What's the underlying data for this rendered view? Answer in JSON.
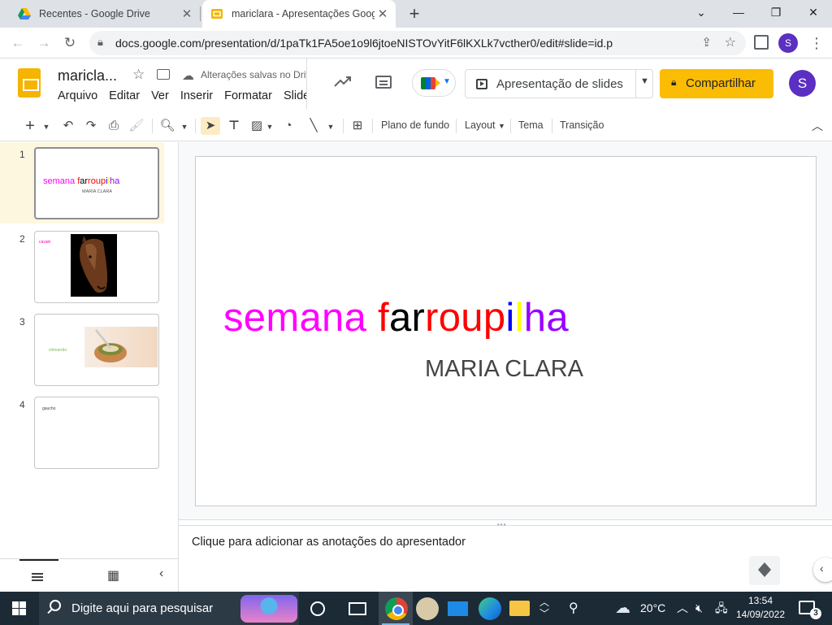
{
  "browser": {
    "tabs": [
      {
        "title": "Recentes - Google Drive",
        "icon": "google-drive-icon",
        "active": false
      },
      {
        "title": "mariclara - Apresentações Google",
        "icon": "google-slides-icon",
        "active": true
      }
    ],
    "url": "docs.google.com/presentation/d/1paTk1FA5oe1o9l6jtoeNISTOvYitF6lKXLk7vcther0/edit#slide=id.p",
    "profile_initial": "S"
  },
  "app": {
    "doc_title": "maricla...",
    "save_status": "Alterações salvas no Drive",
    "menu": [
      "Arquivo",
      "Editar",
      "Ver",
      "Inserir",
      "Formatar",
      "Slide"
    ],
    "present_label": "Apresentação de slides",
    "share_label": "Compartilhar",
    "user_initial": "S",
    "colors": {
      "share": "#fbbc04",
      "avatar": "#5b2fc1",
      "slides_logo": "#f4b400"
    }
  },
  "toolbar": {
    "background": "Plano de fundo",
    "layout": "Layout",
    "theme": "Tema",
    "transition": "Transição"
  },
  "filmstrip": {
    "slides": [
      {
        "number": "1",
        "title": "semana farroupilha",
        "subtitle": "MARIA CLARA",
        "active": true
      },
      {
        "number": "2",
        "text": "cavalo",
        "image": "horse-photo"
      },
      {
        "number": "3",
        "text": "chimarrão",
        "image": "mate-gourd-photo"
      },
      {
        "number": "4",
        "text": "gaucho"
      }
    ]
  },
  "slide": {
    "title_segments": [
      {
        "text": "semana ",
        "color": "#ff00ff"
      },
      {
        "text": "f",
        "color": "#ff0000"
      },
      {
        "text": "ar",
        "color": "#000000"
      },
      {
        "text": "roup",
        "color": "#ff0000"
      },
      {
        "text": "i",
        "color": "#0000ff"
      },
      {
        "text": "l",
        "color": "#ffff00"
      },
      {
        "text": "ha",
        "color": "#9900ff"
      }
    ],
    "subtitle": "MARIA CLARA"
  },
  "notes": {
    "placeholder": "Clique para adicionar as anotações do apresentador"
  },
  "taskbar": {
    "search_placeholder": "Digite aqui para pesquisar",
    "weather": "20°C",
    "time": "13:54",
    "date": "14/09/2022",
    "notification_count": "3"
  }
}
